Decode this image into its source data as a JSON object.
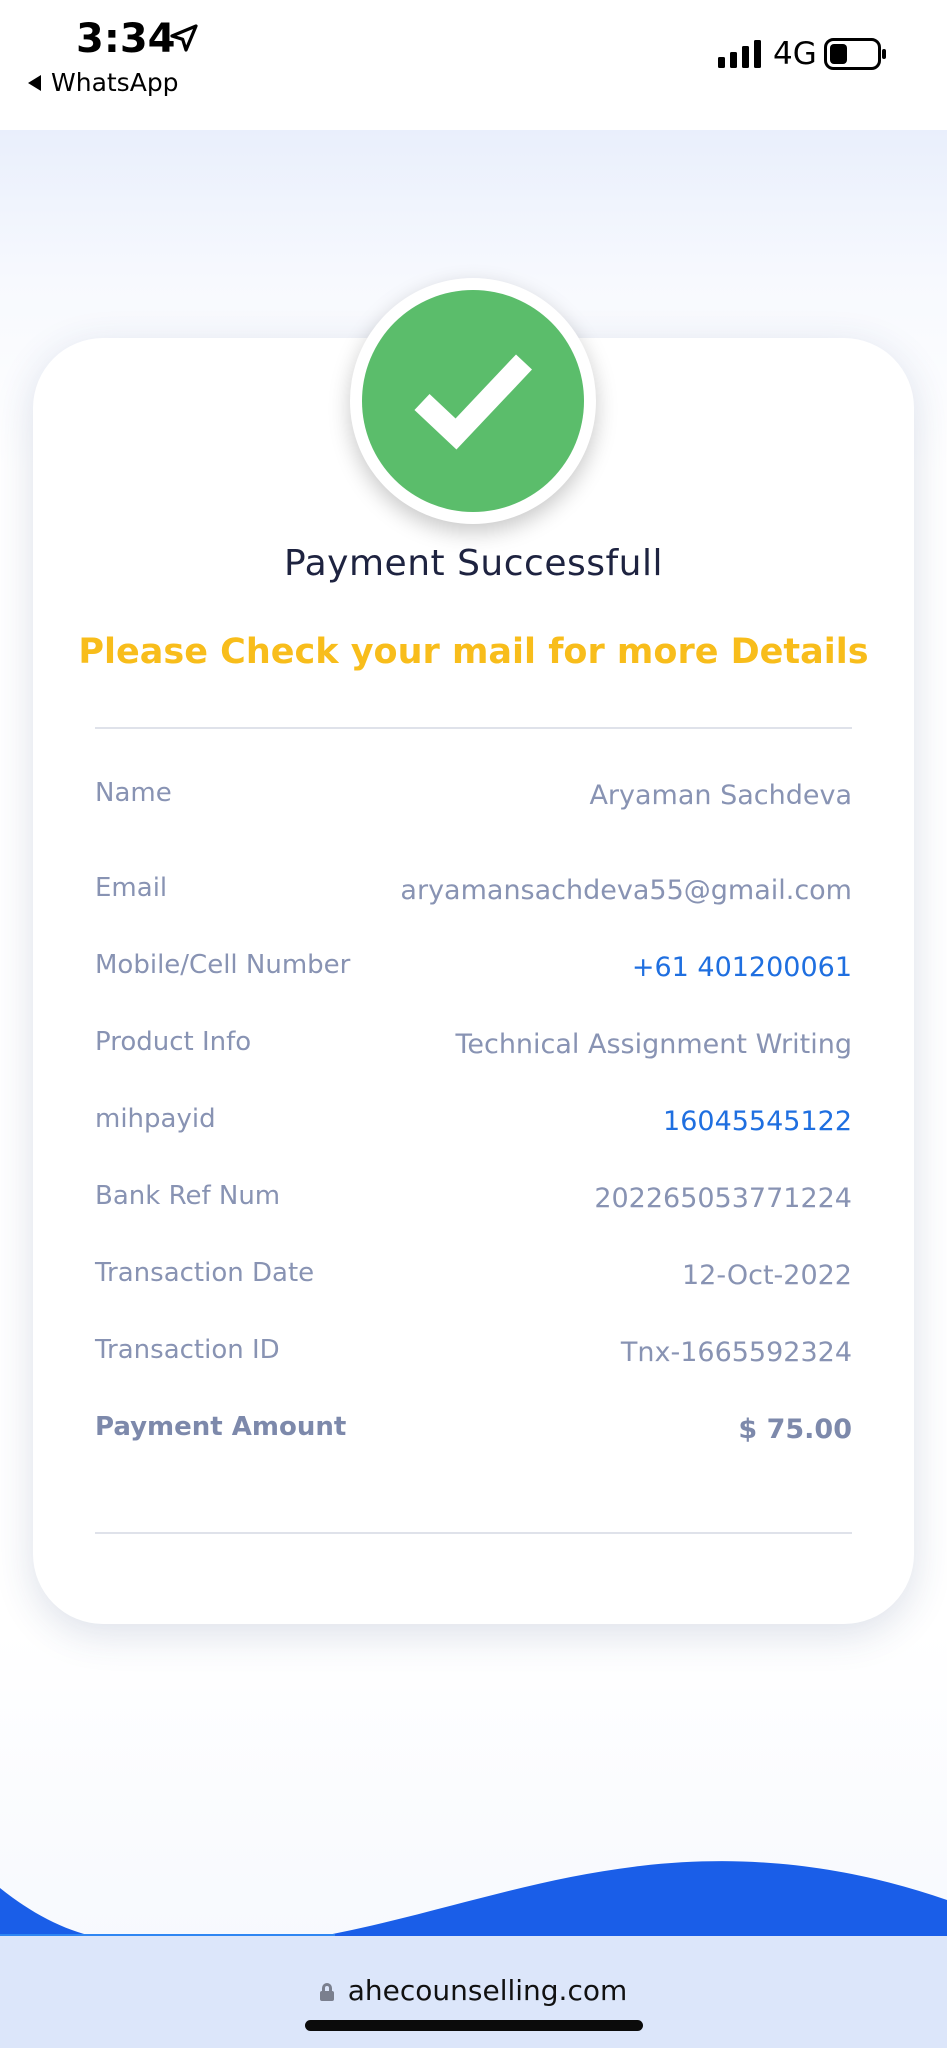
{
  "status_bar": {
    "time": "3:34",
    "back_app": "WhatsApp",
    "network": "4G",
    "icons": [
      "location-arrow-icon",
      "signal-bars-icon",
      "battery-icon"
    ]
  },
  "payment": {
    "title": "Payment Successfull",
    "subtitle": "Please Check your mail for more Details",
    "icon": "checkmark-icon",
    "rows": [
      {
        "label": "Name",
        "value": "Aryaman Sachdeva"
      },
      {
        "label": "Email",
        "value": "aryamansachdeva55@gmail.com"
      },
      {
        "label": "Mobile/Cell Number",
        "value": "+61 401200061"
      },
      {
        "label": "Product Info",
        "value": "Technical Assignment Writing"
      },
      {
        "label": "mihpayid",
        "value": "16045545122"
      },
      {
        "label": "Bank Ref Num",
        "value": "202265053771224"
      },
      {
        "label": "Transaction Date",
        "value": "12-Oct-2022"
      },
      {
        "label": "Transaction ID",
        "value": "Tnx-1665592324"
      },
      {
        "label": "Payment Amount",
        "value": "$ 75.00"
      }
    ]
  },
  "browser": {
    "url": "ahecounselling.com"
  },
  "colors": {
    "success_green": "#5bbd6b",
    "notice_yellow": "#f8bd1b",
    "link_blue": "#1f6fe0",
    "wave_blue": "#1a5ee8",
    "label_gray": "#8893b3"
  }
}
